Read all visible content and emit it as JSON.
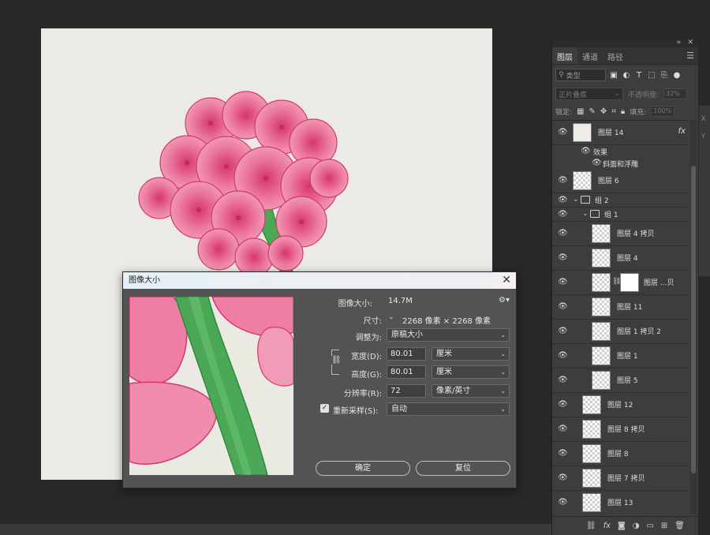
{
  "layers_panel": {
    "tabs": [
      "图层",
      "通道",
      "路径"
    ],
    "active_tab": 0,
    "filter_placeholder": "类型",
    "blend_mode": "正片叠底",
    "opacity_label": "不透明度:",
    "opacity_value": "32%",
    "lock_label": "锁定:",
    "fill_label": "填充:",
    "fill_value": "100%",
    "layers": [
      {
        "name": "图层 14",
        "kind": "layer",
        "thumb": "cream",
        "fx": "fx",
        "indent": 0
      },
      {
        "name": "效果",
        "kind": "effect",
        "indent": 0
      },
      {
        "name": "斜面和浮雕",
        "kind": "effect-item",
        "indent": 0
      },
      {
        "name": "图层 6",
        "kind": "layer",
        "thumb": "checker",
        "indent": 0
      },
      {
        "name": "组 2",
        "kind": "group",
        "indent": 0
      },
      {
        "name": "组 1",
        "kind": "group",
        "indent": 1
      },
      {
        "name": "图层 4 拷贝",
        "kind": "layer",
        "thumb": "checker",
        "indent": 2
      },
      {
        "name": "图层 4",
        "kind": "layer",
        "thumb": "checker",
        "indent": 2
      },
      {
        "name": "图层 ...贝",
        "kind": "masked",
        "thumb": "checker",
        "indent": 2
      },
      {
        "name": "图层 11",
        "kind": "layer",
        "thumb": "checker",
        "indent": 2
      },
      {
        "name": "图层 1 拷贝 2",
        "kind": "layer",
        "thumb": "checker",
        "indent": 2
      },
      {
        "name": "图层 1",
        "kind": "layer",
        "thumb": "checker",
        "indent": 2
      },
      {
        "name": "图层 5",
        "kind": "layer",
        "thumb": "checker",
        "indent": 2
      },
      {
        "name": "图层 12",
        "kind": "layer",
        "thumb": "checker",
        "indent": 1
      },
      {
        "name": "图层 8 拷贝",
        "kind": "layer",
        "thumb": "checker",
        "indent": 1
      },
      {
        "name": "图层 8",
        "kind": "layer",
        "thumb": "checker",
        "indent": 1
      },
      {
        "name": "图层 7 拷贝",
        "kind": "layer",
        "thumb": "checker",
        "indent": 1
      },
      {
        "name": "图层 13",
        "kind": "layer",
        "thumb": "checker",
        "indent": 1
      }
    ]
  },
  "side_mini": {
    "x_label": "X",
    "y_label": "Y"
  },
  "dialog": {
    "title": "图像大小",
    "image_size_label": "图像大小:",
    "image_size_value": "14.7M",
    "dimensions_label": "尺寸:",
    "dimensions_value": "2268 像素 × 2268 像素",
    "fit_to_label": "调整为:",
    "fit_to_value": "原稿大小",
    "width_label": "宽度(D):",
    "width_value": "80.01",
    "width_unit": "厘米",
    "height_label": "高度(G):",
    "height_value": "80.01",
    "height_unit": "厘米",
    "resolution_label": "分辨率(R):",
    "resolution_value": "72",
    "resolution_unit": "像素/英寸",
    "resample_label": "重新采样(S):",
    "resample_value": "自动",
    "resample_checked": true,
    "ok_label": "确定",
    "reset_label": "复位"
  },
  "colors": {
    "flower_pink": "#e8608e",
    "stem_green": "#3fa24e",
    "paper": "#ebeae4",
    "panel_bg": "#3d3d3d",
    "dialog_bg": "#535353"
  }
}
